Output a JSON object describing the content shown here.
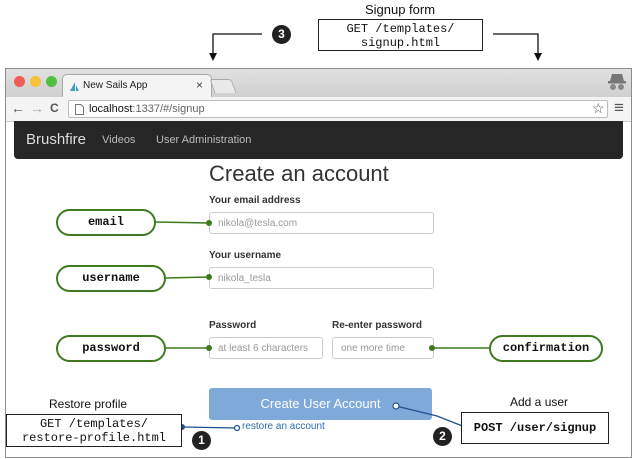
{
  "annotations": {
    "signup_form": {
      "label": "Signup form",
      "code_line1": "GET /templates/",
      "code_line2": "signup.html",
      "number": "3"
    },
    "restore_profile": {
      "label": "Restore profile",
      "code_line1": "GET /templates/",
      "code_line2": "restore-profile.html",
      "number": "1"
    },
    "add_user": {
      "label": "Add a user",
      "code": "POST /user/signup",
      "number": "2"
    },
    "pills": {
      "email": "email",
      "username": "username",
      "password": "password",
      "confirmation": "confirmation"
    }
  },
  "browser": {
    "tab_title": "New Sails App",
    "tab_close": "×",
    "url_host": "localhost",
    "url_path": ":1337/#/signup",
    "nav_back": "←",
    "nav_forward": "→",
    "nav_reload": "C",
    "star": "☆",
    "menu": "≡"
  },
  "app": {
    "brand": "Brushfire",
    "nav": [
      "Videos",
      "User Administration"
    ],
    "heading": "Create an account",
    "email_label": "Your email address",
    "email_placeholder": "nikola@tesla.com",
    "username_label": "Your username",
    "username_placeholder": "nikola_tesla",
    "password_label": "Password",
    "password_placeholder": "at least 6 characters",
    "confirm_label": "Re-enter password",
    "confirm_placeholder": "one more time",
    "submit": "Create User Account",
    "restore_link": "restore an account"
  },
  "colors": {
    "pill_border": "#3f7a1e",
    "connector": "#3f7a1e",
    "link_line": "#1f4f8f",
    "button": "#7ea9d8",
    "navbar": "#262626"
  }
}
